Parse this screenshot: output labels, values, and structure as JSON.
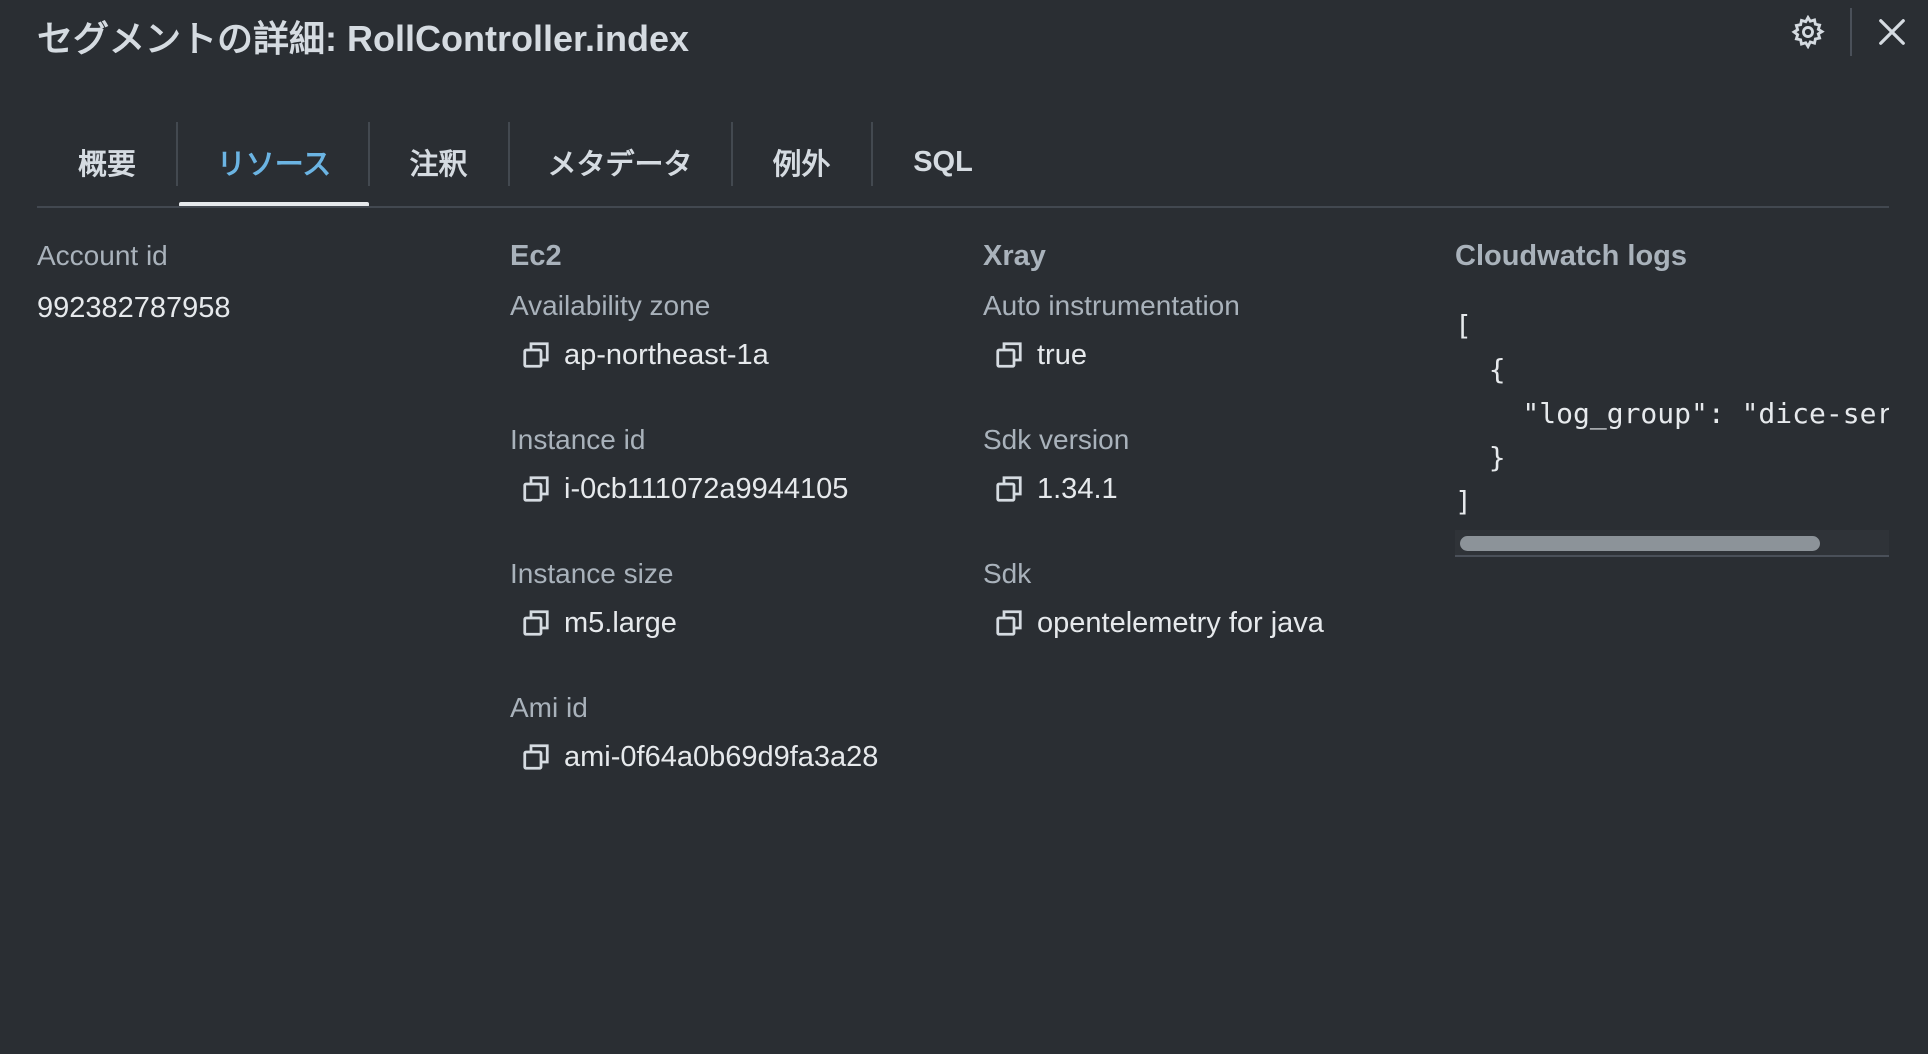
{
  "header": {
    "title": "セグメントの詳細: RollController.index",
    "settings_icon": "gear-icon",
    "close_icon": "close-icon"
  },
  "tabs": [
    {
      "label": "概要",
      "active": false
    },
    {
      "label": "リソース",
      "active": true
    },
    {
      "label": "注釈",
      "active": false
    },
    {
      "label": "メタデータ",
      "active": false
    },
    {
      "label": "例外",
      "active": false
    },
    {
      "label": "SQL",
      "active": false
    }
  ],
  "account": {
    "label": "Account id",
    "value": "992382787958"
  },
  "ec2": {
    "heading": "Ec2",
    "fields": [
      {
        "label": "Availability zone",
        "value": "ap-northeast-1a"
      },
      {
        "label": "Instance id",
        "value": "i-0cb111072a9944105"
      },
      {
        "label": "Instance size",
        "value": "m5.large"
      },
      {
        "label": "Ami id",
        "value": "ami-0f64a0b69d9fa3a28"
      }
    ]
  },
  "xray": {
    "heading": "Xray",
    "fields": [
      {
        "label": "Auto instrumentation",
        "value": "true"
      },
      {
        "label": "Sdk version",
        "value": "1.34.1"
      },
      {
        "label": "Sdk",
        "value": "opentelemetry for java"
      }
    ]
  },
  "cloudwatch": {
    "heading": "Cloudwatch logs",
    "code": "[\n  {\n    \"log_group\": \"dice-ser\n  }\n]"
  },
  "colors": {
    "background": "#2a2e33",
    "accent": "#6bb4e3",
    "text": "#e6e9ec",
    "muted": "#a9b2bb"
  }
}
